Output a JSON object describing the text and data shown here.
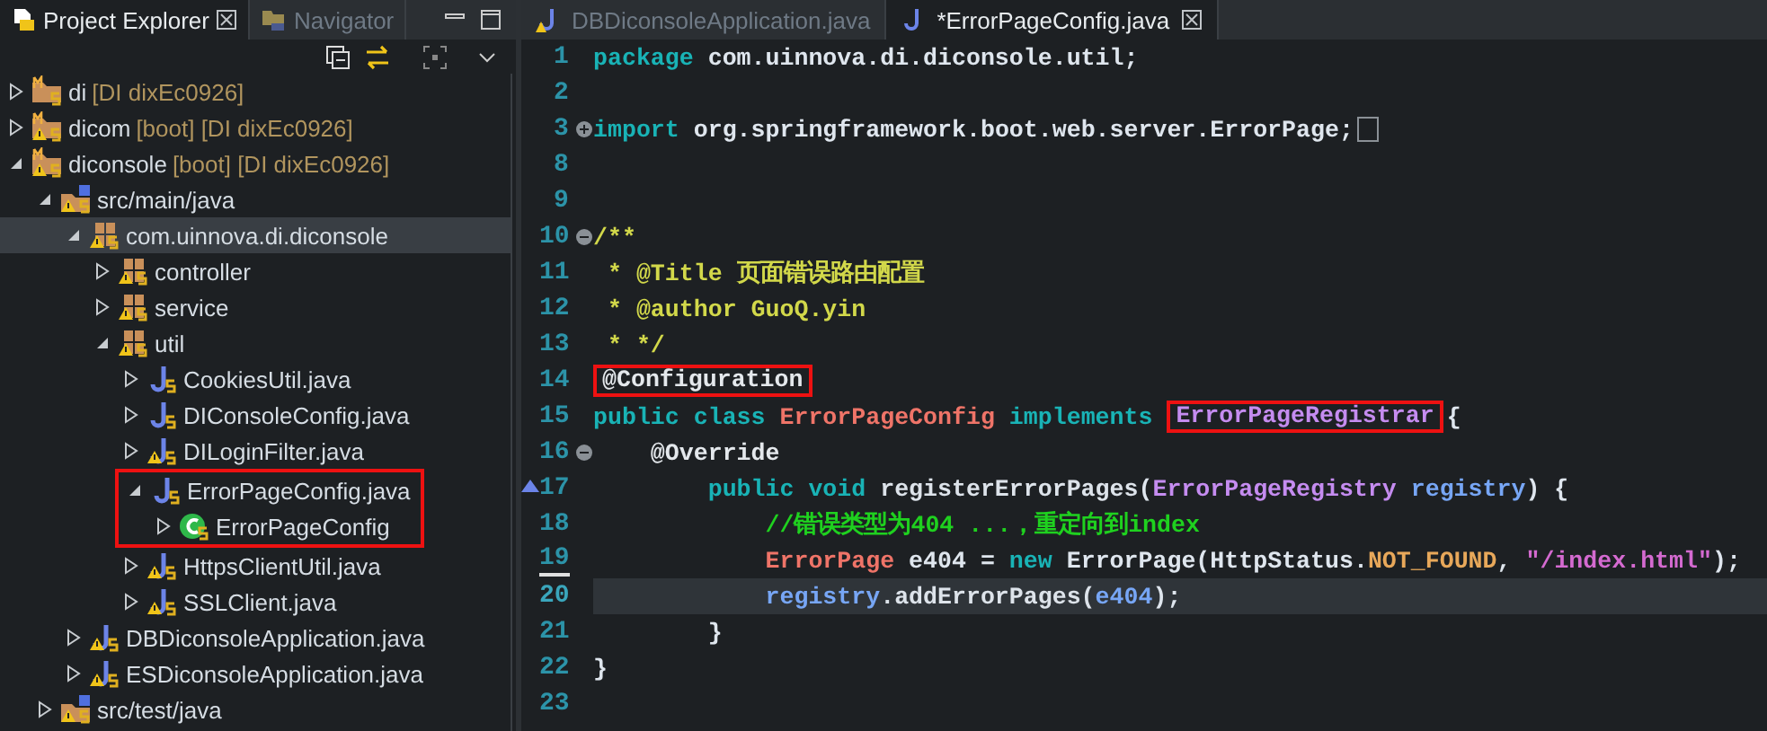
{
  "explorer": {
    "tabs": [
      {
        "label": "Project Explorer",
        "selected": true,
        "closable": true
      },
      {
        "label": "Navigator",
        "selected": false,
        "closable": false
      }
    ],
    "tree": [
      {
        "label": "di",
        "decoration": "[DI dixEc0926]",
        "kind": "project",
        "warning": false,
        "expanded": false,
        "selected": false
      },
      {
        "label": "dicom",
        "decoration": "[boot] [DI dixEc0926]",
        "kind": "project",
        "warning": true,
        "expanded": false,
        "selected": false
      },
      {
        "label": "diconsole",
        "decoration": "[boot] [DI dixEc0926]",
        "kind": "project",
        "warning": true,
        "expanded": true,
        "selected": false,
        "children": [
          {
            "label": "src/main/java",
            "kind": "source",
            "warning": true,
            "expanded": true,
            "selected": false,
            "children": [
              {
                "label": "com.uinnova.di.diconsole",
                "kind": "package",
                "warning": true,
                "expanded": true,
                "selected": true,
                "children": [
                  {
                    "label": "controller",
                    "kind": "package",
                    "warning": true,
                    "expanded": false,
                    "selected": false
                  },
                  {
                    "label": "service",
                    "kind": "package",
                    "warning": true,
                    "expanded": false,
                    "selected": false
                  },
                  {
                    "label": "util",
                    "kind": "package",
                    "warning": true,
                    "expanded": true,
                    "selected": false,
                    "children": [
                      {
                        "label": "CookiesUtil.java",
                        "kind": "file",
                        "warning": false,
                        "expanded": false,
                        "selected": false
                      },
                      {
                        "label": "DIConsoleConfig.java",
                        "kind": "file",
                        "warning": false,
                        "expanded": false,
                        "selected": false
                      },
                      {
                        "label": "DILoginFilter.java",
                        "kind": "file",
                        "warning": true,
                        "expanded": false,
                        "selected": false
                      },
                      {
                        "label": "ErrorPageConfig.java",
                        "kind": "file",
                        "warning": false,
                        "expanded": true,
                        "selected": false,
                        "boxed": true,
                        "children": [
                          {
                            "label": "ErrorPageConfig",
                            "kind": "class",
                            "warning": false,
                            "expanded": false,
                            "selected": false
                          }
                        ]
                      },
                      {
                        "label": "HttpsClientUtil.java",
                        "kind": "file",
                        "warning": true,
                        "expanded": false,
                        "selected": false
                      },
                      {
                        "label": "SSLClient.java",
                        "kind": "file",
                        "warning": true,
                        "expanded": false,
                        "selected": false
                      }
                    ]
                  }
                ]
              },
              {
                "label": "DBDiconsoleApplication.java",
                "kind": "file",
                "warning": true,
                "expanded": false,
                "selected": false
              },
              {
                "label": "ESDiconsoleApplication.java",
                "kind": "file",
                "warning": true,
                "expanded": false,
                "selected": false
              }
            ]
          },
          {
            "label": "src/test/java",
            "kind": "source",
            "warning": true,
            "expanded": false,
            "selected": false
          }
        ]
      }
    ]
  },
  "editor": {
    "tabs": [
      {
        "label": "DBDiconsoleApplication.java",
        "selected": false,
        "warning": true
      },
      {
        "label": "*ErrorPageConfig.java",
        "selected": true,
        "warning": false
      }
    ],
    "lines": [
      {
        "number": "1",
        "kind": "code",
        "current": false,
        "tokens": [
          {
            "text": "package",
            "kind": "keyword"
          },
          {
            "text": " com.uinnova.di.diconsole.util;",
            "kind": "plain"
          }
        ]
      },
      {
        "number": "2",
        "kind": "code",
        "current": false
      },
      {
        "number": "3",
        "kind": "folded",
        "current": false,
        "tokens": [
          {
            "text": "import",
            "kind": "keyword"
          },
          {
            "text": " org.springframework.boot.web.server.ErrorPage;",
            "kind": "plain"
          }
        ]
      },
      {
        "number": "8",
        "kind": "code",
        "current": false
      },
      {
        "number": "9",
        "kind": "code",
        "current": false
      },
      {
        "number": "10",
        "kind": "foldable",
        "current": false,
        "tokens": [
          {
            "text": "/**",
            "kind": "doc"
          }
        ]
      },
      {
        "number": "11",
        "kind": "code",
        "current": false,
        "tokens": [
          {
            "text": " * @Title 页面错误路由配置",
            "kind": "doc"
          }
        ]
      },
      {
        "number": "12",
        "kind": "code",
        "current": false,
        "tokens": [
          {
            "text": " * @author GuoQ.yin",
            "kind": "doc"
          }
        ]
      },
      {
        "number": "13",
        "kind": "code",
        "current": false,
        "tokens": [
          {
            "text": " * */",
            "kind": "doc"
          }
        ]
      },
      {
        "number": "14",
        "kind": "code",
        "current": false,
        "tokens": [
          {
            "text": "@Configuration",
            "kind": "annotation",
            "boxed": true
          }
        ]
      },
      {
        "number": "15",
        "kind": "code",
        "current": false,
        "tokens": [
          {
            "text": "public class ",
            "kind": "keyword"
          },
          {
            "text": "ErrorPageConfig",
            "kind": "type"
          },
          {
            "text": " implements ",
            "kind": "keyword"
          },
          {
            "text": "ErrorPageRegistrar",
            "kind": "interface",
            "boxed": true
          },
          {
            "text": "{",
            "kind": "plain"
          }
        ]
      },
      {
        "number": "16",
        "kind": "foldable",
        "current": false,
        "tokens": [
          {
            "text": "    @Override",
            "kind": "annotation"
          }
        ]
      },
      {
        "number": "17",
        "kind": "override",
        "current": false,
        "tokens": [
          {
            "text": "        public void ",
            "kind": "keyword"
          },
          {
            "text": "registerErrorPages",
            "kind": "method"
          },
          {
            "text": "(",
            "kind": "plain"
          },
          {
            "text": "ErrorPageRegistry",
            "kind": "interface"
          },
          {
            "text": " registry",
            "kind": "variable"
          },
          {
            "text": ") {",
            "kind": "plain"
          }
        ]
      },
      {
        "number": "18",
        "kind": "code",
        "current": false,
        "tokens": [
          {
            "text": "            //错误类型为404 ...，重定向到index",
            "kind": "comment"
          }
        ]
      },
      {
        "number": "19",
        "kind": "code",
        "current": false,
        "underlined": true,
        "tokens": [
          {
            "text": "            ErrorPage",
            "kind": "type"
          },
          {
            "text": " e404 = ",
            "kind": "plain"
          },
          {
            "text": "new",
            "kind": "keyword"
          },
          {
            "text": " ErrorPage(HttpStatus.",
            "kind": "plain"
          },
          {
            "text": "NOT_FOUND",
            "kind": "constant"
          },
          {
            "text": ", ",
            "kind": "plain"
          },
          {
            "text": "\"/index.html\"",
            "kind": "string"
          },
          {
            "text": ");",
            "kind": "plain"
          }
        ]
      },
      {
        "number": "20",
        "kind": "code",
        "current": true,
        "tokens": [
          {
            "text": "            registry",
            "kind": "variable"
          },
          {
            "text": ".addErrorPages(",
            "kind": "method"
          },
          {
            "text": "e404",
            "kind": "variable"
          },
          {
            "text": ");",
            "kind": "plain"
          }
        ]
      },
      {
        "number": "21",
        "kind": "code",
        "current": false,
        "tokens": [
          {
            "text": "        }",
            "kind": "plain"
          }
        ]
      },
      {
        "number": "22",
        "kind": "code",
        "current": false,
        "tokens": [
          {
            "text": "}",
            "kind": "plain"
          }
        ]
      },
      {
        "number": "23",
        "kind": "code",
        "current": false
      }
    ]
  }
}
